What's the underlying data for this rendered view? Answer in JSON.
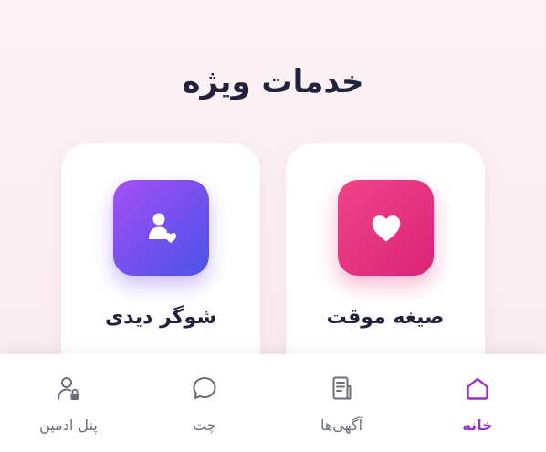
{
  "page": {
    "title": "خدمات ویژه"
  },
  "cards": [
    {
      "label": "صیغه موقت",
      "icon": "heart-icon",
      "accent": "#e33183"
    },
    {
      "label": "شوگر دیدی",
      "icon": "user-heart-icon",
      "accent": "#6f4df0"
    }
  ],
  "bottom_nav": {
    "active_color": "#9a2fcf",
    "items": [
      {
        "label": "خانه",
        "icon": "home-icon",
        "active": true
      },
      {
        "label": "آگهی‌ها",
        "icon": "document-icon",
        "active": false
      },
      {
        "label": "چت",
        "icon": "chat-icon",
        "active": false
      },
      {
        "label": "پنل ادمین",
        "icon": "admin-user-lock-icon",
        "active": false
      }
    ]
  }
}
